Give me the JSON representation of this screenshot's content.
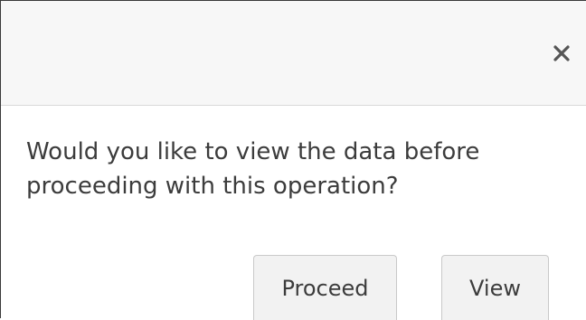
{
  "dialog": {
    "close_symbol": "×",
    "message": "Would you like to view the data before proceeding with this operation?",
    "buttons": {
      "proceed_label": "Proceed",
      "view_label": "View"
    }
  },
  "colors": {
    "header_bg": "#f7f7f7",
    "button_bg": "#f2f2f2",
    "text": "#3c3c3c",
    "close_icon": "#555555"
  }
}
